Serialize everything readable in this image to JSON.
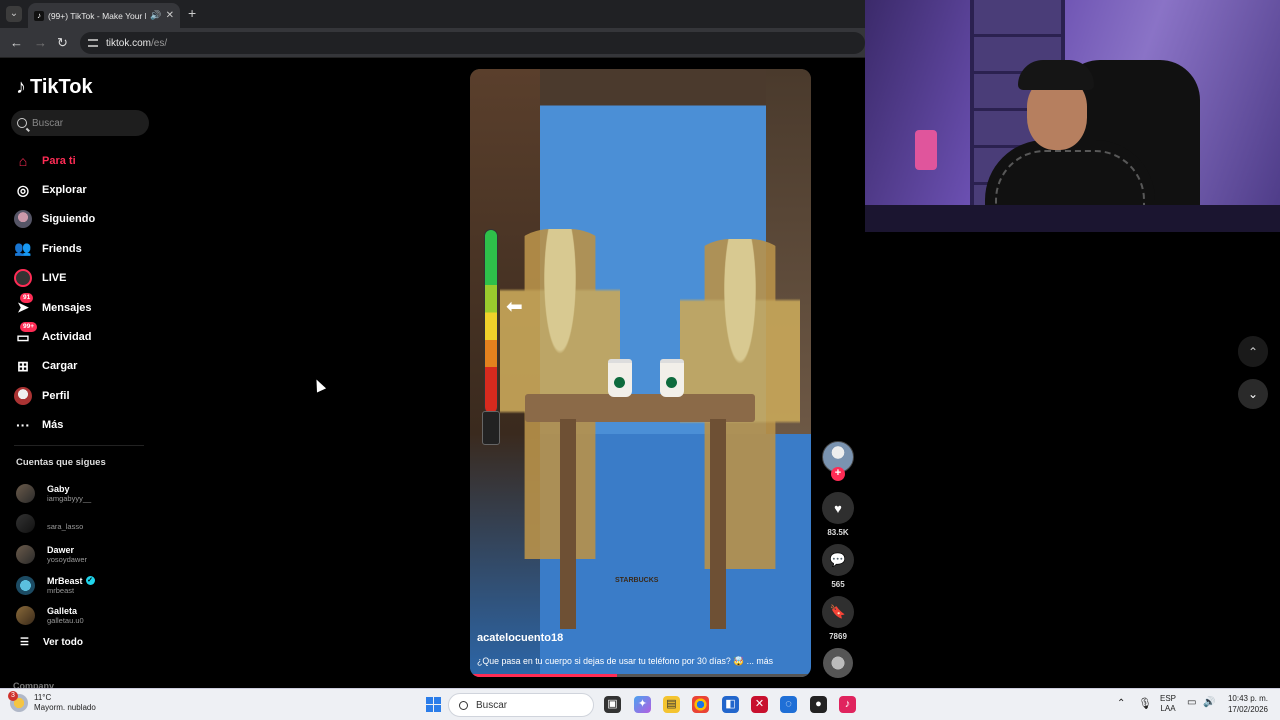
{
  "browser": {
    "tab_menu_icon": "chevron-down-icon",
    "tab_title": "(99+) TikTok - Make Your D...",
    "url_host": "tiktok.com",
    "url_path": "/es/"
  },
  "tiktok": {
    "brand": "TikTok",
    "search_placeholder": "Buscar",
    "nav": [
      {
        "label": "Para ti",
        "icon": "home-icon"
      },
      {
        "label": "Explorar",
        "icon": "compass-icon"
      },
      {
        "label": "Siguiendo",
        "icon": "avatar-icon"
      },
      {
        "label": "Friends",
        "icon": "friends-icon"
      },
      {
        "label": "LIVE",
        "icon": "live-icon"
      },
      {
        "label": "Mensajes",
        "icon": "send-icon",
        "badge": "91"
      },
      {
        "label": "Actividad",
        "icon": "inbox-icon",
        "badge": "99+"
      },
      {
        "label": "Cargar",
        "icon": "plus-square-icon"
      },
      {
        "label": "Perfil",
        "icon": "profile-icon"
      },
      {
        "label": "Más",
        "icon": "more-icon"
      }
    ],
    "following_header": "Cuentas que sigues",
    "following": [
      {
        "name": "Gaby",
        "handle": "iamgabyyy__"
      },
      {
        "name": "",
        "handle": "sara_lasso"
      },
      {
        "name": "Dawer",
        "handle": "yosoydawer"
      },
      {
        "name": "MrBeast",
        "handle": "mrbeast",
        "verified": true
      },
      {
        "name": "Galleta",
        "handle": "galletau.u0"
      }
    ],
    "see_all": "Ver todo",
    "company": "Company",
    "video": {
      "author": "acatelocuento18",
      "caption": "¿Que pasa en tu cuerpo si dejas de usar tu teléfono por 30 días? 🤯 ... más",
      "progress": 0.43,
      "overlay_text": "STARBUCKS"
    },
    "actions": {
      "likes": "83.5K",
      "comments": "565",
      "saves": "7869"
    }
  },
  "taskbar": {
    "temp": "11°C",
    "weather": "Mayorm. nublado",
    "weather_badge": "3",
    "search": "Buscar",
    "lang_top": "ESP",
    "lang_bottom": "LAA",
    "time": "10:43 p. m.",
    "date": "17/02/2026"
  }
}
